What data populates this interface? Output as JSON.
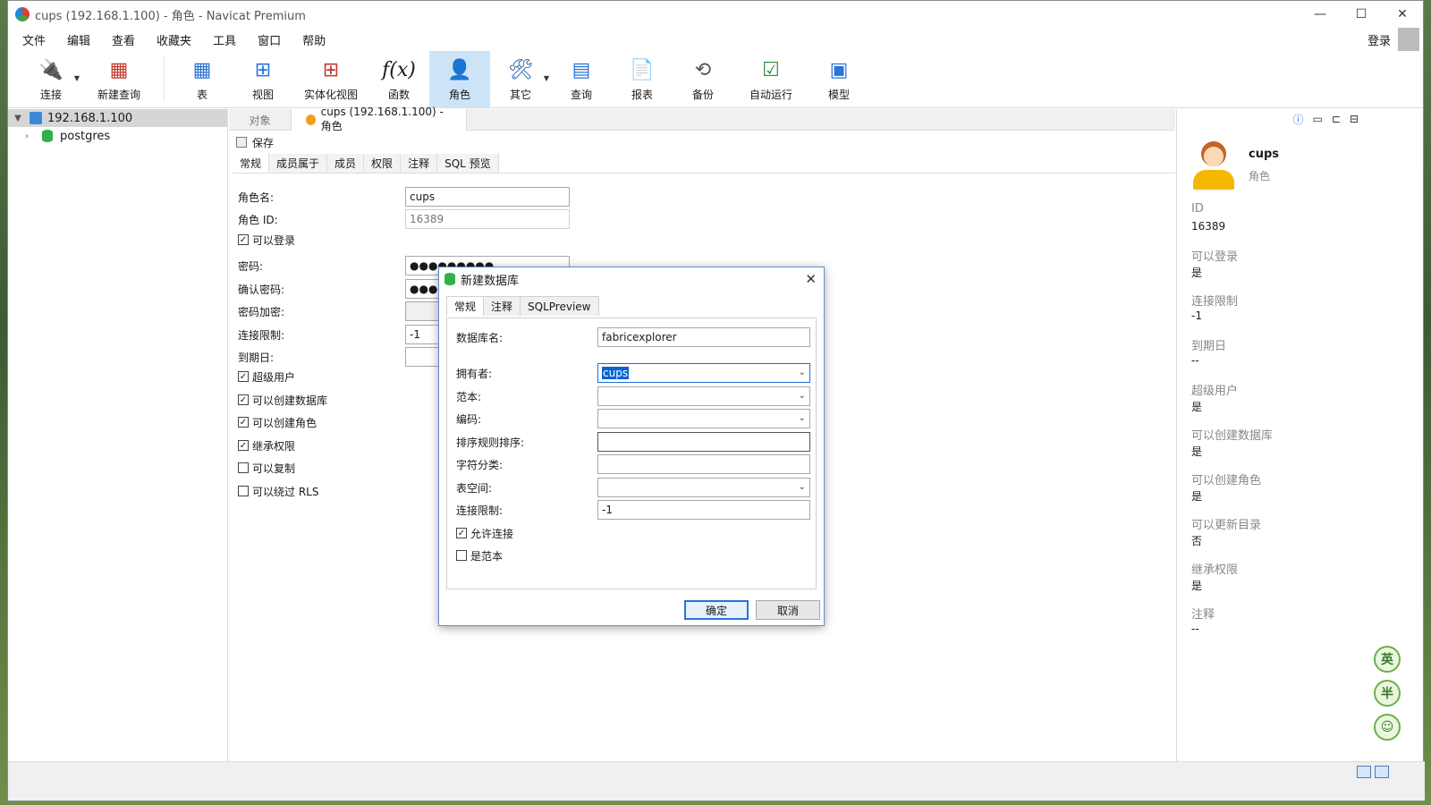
{
  "window": {
    "title": "cups (192.168.1.100) - 角色 - Navicat Premium"
  },
  "menu": [
    "文件",
    "编辑",
    "查看",
    "收藏夹",
    "工具",
    "窗口",
    "帮助"
  ],
  "login_label": "登录",
  "toolbar": {
    "connect": "连接",
    "new_query": "新建查询",
    "table": "表",
    "view": "视图",
    "mat_view": "实体化视图",
    "function": "函数",
    "role": "角色",
    "other": "其它",
    "query": "查询",
    "report": "报表",
    "backup": "备份",
    "auto_run": "自动运行",
    "model": "模型"
  },
  "tree": {
    "server": "192.168.1.100",
    "database": "postgres"
  },
  "tabs": {
    "objects": "对象",
    "role_tab": "cups (192.168.1.100) - 角色"
  },
  "save_label": "保存",
  "subtabs": [
    "常规",
    "成员属于",
    "成员",
    "权限",
    "注释",
    "SQL 预览"
  ],
  "role_form": {
    "role_name_label": "角色名:",
    "role_name": "cups",
    "role_id_label": "角色 ID:",
    "role_id": "16389",
    "can_login": "可以登录",
    "password_label": "密码:",
    "password": "●●●●●●●●●",
    "confirm_label": "确认密码:",
    "confirm": "●●●●",
    "encrypt_label": "密码加密:",
    "conn_limit_label": "连接限制:",
    "conn_limit": "-1",
    "expiry_label": "到期日:",
    "superuser": "超级用户",
    "create_db": "可以创建数据库",
    "create_role": "可以创建角色",
    "inherit": "继承权限",
    "replication": "可以复制",
    "bypass_rls": "可以绕过 RLS"
  },
  "dialog": {
    "title": "新建数据库",
    "tabs": [
      "常规",
      "注释",
      "SQLPreview"
    ],
    "db_name_label": "数据库名:",
    "db_name": "fabricexplorer",
    "owner_label": "拥有者:",
    "owner": "cups",
    "template_label": "范本:",
    "encoding_label": "编码:",
    "collation_label": "排序规则排序:",
    "ctype_label": "字符分类:",
    "tablespace_label": "表空间:",
    "conn_limit_label": "连接限制:",
    "conn_limit": "-1",
    "allow_conn": "允许连接",
    "is_template": "是范本",
    "ok": "确定",
    "cancel": "取消"
  },
  "info_panel": {
    "name": "cups",
    "type": "角色",
    "items": [
      {
        "label": "ID",
        "value": "16389"
      },
      {
        "label": "可以登录",
        "value": "是"
      },
      {
        "label": "连接限制",
        "value": "-1"
      },
      {
        "label": "到期日",
        "value": "--"
      },
      {
        "label": "超级用户",
        "value": "是"
      },
      {
        "label": "可以创建数据库",
        "value": "是"
      },
      {
        "label": "可以创建角色",
        "value": "是"
      },
      {
        "label": "可以更新目录",
        "value": "否"
      },
      {
        "label": "继承权限",
        "value": "是"
      },
      {
        "label": "注释",
        "value": "--"
      }
    ]
  },
  "ime": [
    "英",
    "半"
  ],
  "colors": {
    "accent": "#1e6fd9",
    "selection": "#cde4f7"
  }
}
